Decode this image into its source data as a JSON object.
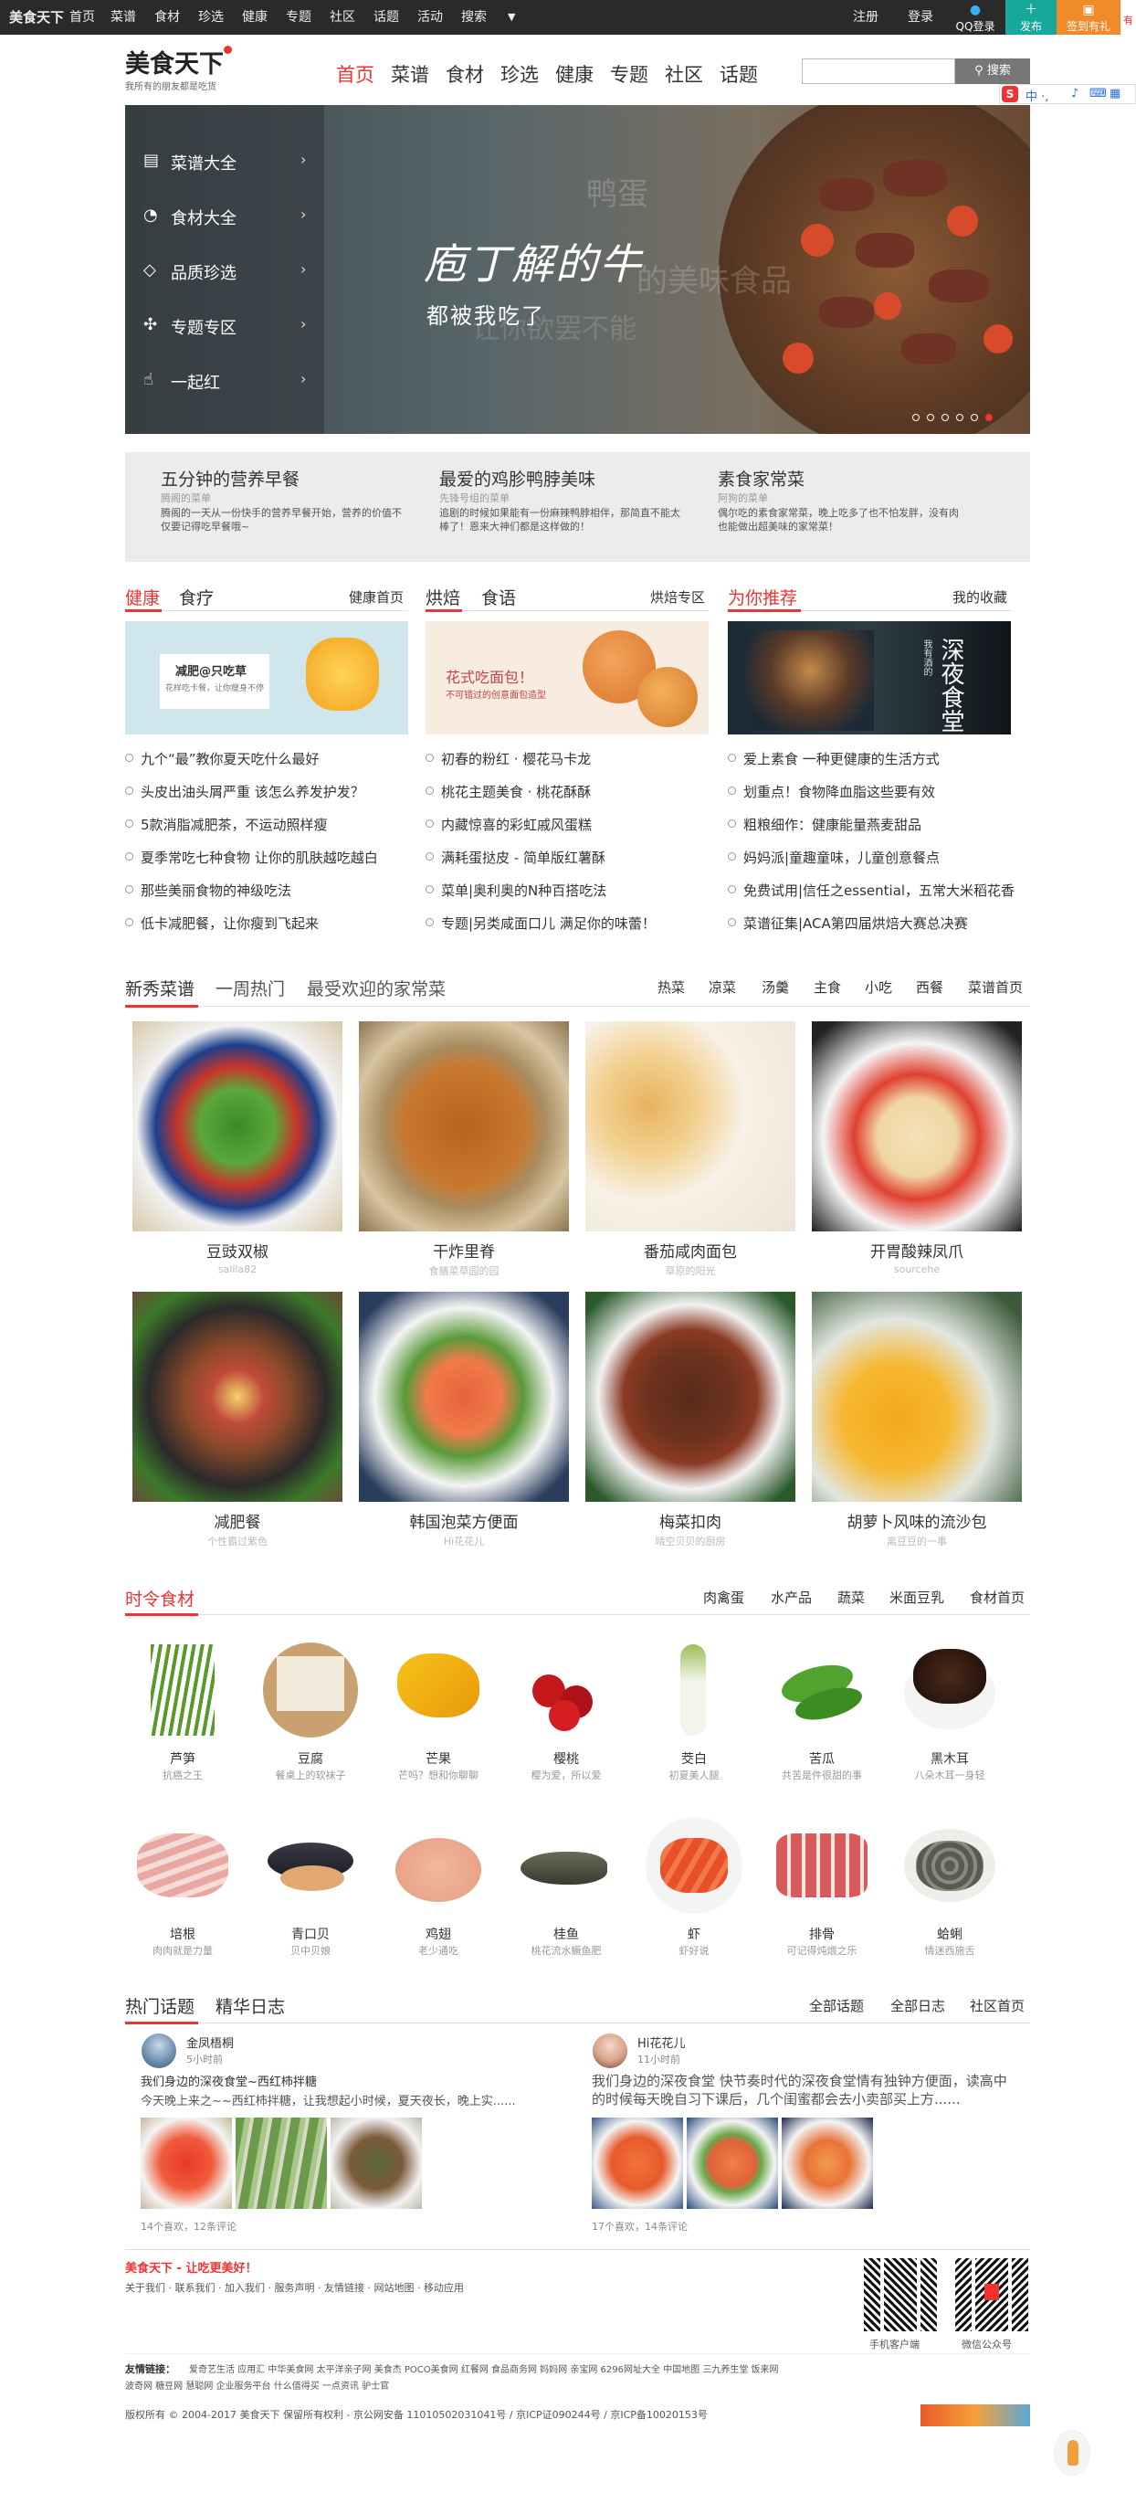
{
  "topbar": {
    "logo": "美食天下",
    "nav": [
      "首页",
      "菜谱",
      "食材",
      "珍选",
      "健康",
      "专题",
      "社区",
      "话题",
      "活动",
      "搜索"
    ],
    "register": "注册",
    "login": "登录",
    "qq": "QQ登录",
    "publish": "发布",
    "signin": "签到有礼",
    "extra": "有"
  },
  "header": {
    "brand": "美食天下",
    "slogan": "我所有的朋友都是吃货",
    "nav": [
      "首页",
      "菜谱",
      "食材",
      "珍选",
      "健康",
      "专题",
      "社区",
      "话题"
    ],
    "search_btn": "搜索"
  },
  "toolbar_icons": "中 ·, ",
  "hero": {
    "menu": [
      "菜谱大全",
      "食材大全",
      "品质珍选",
      "专题专区",
      "一起红"
    ],
    "title": "庖丁解的牛",
    "subtitle": "都被我吃了",
    "bg_words": [
      "鸭蛋",
      "的美味食品",
      "让你欲罢不能"
    ]
  },
  "strip": [
    {
      "title": "五分钟的营养早餐",
      "sub": "腾阁的菜单",
      "desc": "腾阁的一天从一份快手的营养早餐开始，营养的价值不仅要记得吃早餐哦~"
    },
    {
      "title": "最爱的鸡胗鸭脖美味",
      "sub": "先锋号组的菜单",
      "desc": "追剧的时候如果能有一份麻辣鸭脖相伴，那简直不能太棒了！恩来大神们都是这样做的！"
    },
    {
      "title": "素食家常菜",
      "sub": "阿狗的菜单",
      "desc": "偶尔吃的素食家常菜，晚上吃多了也不怕发胖，没有肉也能做出超美味的家常菜！"
    }
  ],
  "health": {
    "tabs": [
      "健康",
      "食疗"
    ],
    "more": "健康首页",
    "banner_text": [
      "减肥@只吃草",
      "花样吃卡餐，让你瘦身不停"
    ],
    "items": [
      "九个“最”教你夏天吃什么最好",
      "头皮出油头屑严重 该怎么养发护发？",
      "5款消脂减肥茶，不运动照样瘦",
      "夏季常吃七种食物 让你的肌肤越吃越白",
      "那些美丽食物的神级吃法",
      "低卡减肥餐，让你瘦到飞起来"
    ]
  },
  "bake": {
    "tabs": [
      "烘焙",
      "食语"
    ],
    "more": "烘焙专区",
    "banner_text": [
      "花式吃面包！",
      "不可错过的创意面包造型"
    ],
    "items": [
      "初春的粉红 · 樱花马卡龙",
      "桃花主题美食 · 桃花酥酥",
      "内藏惊喜的彩虹戚风蛋糕",
      "满耗蛋挞皮 - 简单版红薯酥",
      "菜单|奥利奥的N种百搭吃法",
      "专题|另类咸面口儿 满足你的味蕾！"
    ]
  },
  "recommend": {
    "tabs": [
      "为你推荐"
    ],
    "more": "我的收藏",
    "banner_text": [
      "深夜食堂",
      "我有酒的"
    ],
    "items": [
      "爱上素食 一种更健康的生活方式",
      "划重点！食物降血脂这些要有效",
      "粗粮细作：健康能量燕麦甜品",
      "妈妈派|童趣童味，儿童创意餐点",
      "免费试用|信任之essential，五常大米稻花香",
      "菜谱征集|ACA第四届烘焙大赛总决赛"
    ]
  },
  "recipes": {
    "tabs": [
      "新秀菜谱",
      "一周热门",
      "最受欢迎的家常菜"
    ],
    "links": [
      "热菜",
      "凉菜",
      "汤羹",
      "主食",
      "小吃",
      "西餐",
      "菜谱首页"
    ],
    "list": [
      {
        "title": "豆豉双椒",
        "author": "salila82"
      },
      {
        "title": "干炸里脊",
        "author": "食膳菜草园的园"
      },
      {
        "title": "番茄咸肉面包",
        "author": "草原的阳光"
      },
      {
        "title": "开胃酸辣凤爪",
        "author": "sourcehe"
      },
      {
        "title": "减肥餐",
        "author": "个性霸过紫色"
      },
      {
        "title": "韩国泡菜方便面",
        "author": "Hi花花儿"
      },
      {
        "title": "梅菜扣肉",
        "author": "晴空贝贝的厨房"
      },
      {
        "title": "胡萝卜风味的流沙包",
        "author": "离豆豆的一事"
      }
    ]
  },
  "seasonal": {
    "title": "时令食材",
    "links": [
      "肉禽蛋",
      "水产品",
      "蔬菜",
      "米面豆乳",
      "食材首页"
    ],
    "list": [
      {
        "name": "芦笋",
        "sub": "抗癌之王"
      },
      {
        "name": "豆腐",
        "sub": "餐桌上的软袜子"
      },
      {
        "name": "芒果",
        "sub": "芒吗？想和你聊聊"
      },
      {
        "name": "樱桃",
        "sub": "樱为爱，所以爱"
      },
      {
        "name": "茭白",
        "sub": "初夏美人腿"
      },
      {
        "name": "苦瓜",
        "sub": "共苦是件很甜的事"
      },
      {
        "name": "黑木耳",
        "sub": "八朵木耳一身轻"
      },
      {
        "name": "培根",
        "sub": "肉肉就是力量"
      },
      {
        "name": "青口贝",
        "sub": "贝中贝娘"
      },
      {
        "name": "鸡翅",
        "sub": "老少通吃"
      },
      {
        "name": "桂鱼",
        "sub": "桃花流水鳜鱼肥"
      },
      {
        "name": "虾",
        "sub": "虾好说"
      },
      {
        "name": "排骨",
        "sub": "可记得炖煨之乐"
      },
      {
        "name": "蛤蜊",
        "sub": "情迷西施舌"
      }
    ]
  },
  "topics": {
    "tabs": [
      "热门话题",
      "精华日志"
    ],
    "links": [
      "全部话题",
      "全部日志",
      "社区首页"
    ],
    "posts": [
      {
        "user": "金凤梧桐",
        "time": "5小时前",
        "title": "我们身边的深夜食堂~西红柿拌糖",
        "text": "今天晚上来之~~西红柿拌糖，让我想起小时候，夏天夜长，晚上实......",
        "stats": "14个喜欢，12条评论"
      },
      {
        "user": "Hi花花儿",
        "time": "11小时前",
        "title": "",
        "text": "我们身边的深夜食堂 快节奏时代的深夜食堂情有独钟方便面，读高中的时候每天晚自习下课后，几个闺蜜都会去小卖部买上方......",
        "stats": "17个喜欢，14条评论"
      }
    ]
  },
  "footer": {
    "slogan": "美食天下 - 让吃更美好！",
    "links": "关于我们 · 联系我们 · 加入我们 · 服务声明 · 友情链接 · 网站地图 · 移动应用",
    "qr1": "手机客户端",
    "qr2": "微信公众号",
    "friends_label": "友情链接：",
    "friends1": "爱奇艺生活   应用汇   中华美食网   太平洋亲子网   美食杰   POCO美食网   红餐网   食品商务网   妈妈网   亲宝网   6296网址大全   中国地图   三九养生堂   饭来网",
    "friends2": "波奇网   糖豆网   慧聪网   企业服务平台   什么值得买   一点资讯   驴士官",
    "copyright": "版权所有 © 2004-2017 美食天下 保留所有权利 - 京公网安备 11010502031041号 / 京ICP证090244号 / 京ICP备10020153号"
  }
}
